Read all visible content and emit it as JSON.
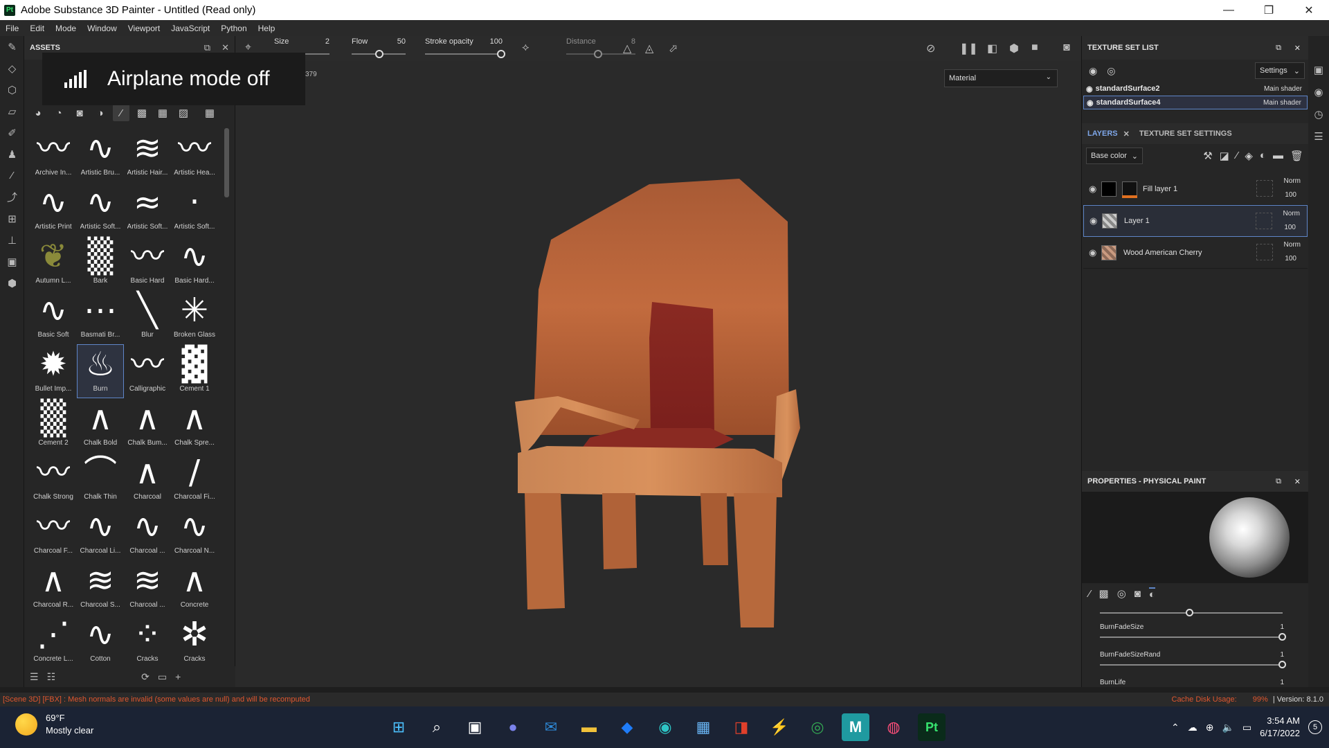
{
  "window": {
    "title": "Adobe Substance 3D Painter - Untitled (Read only)",
    "badge": "Pt",
    "minimize": "—",
    "maximize": "❐",
    "close": "✕"
  },
  "menu": [
    "File",
    "Edit",
    "Mode",
    "Window",
    "Viewport",
    "JavaScript",
    "Python",
    "Help"
  ],
  "assets": {
    "title": "ASSETS",
    "items": [
      "Archive In...",
      "Artistic Bru...",
      "Artistic Hair...",
      "Artistic Hea...",
      "Artistic Print",
      "Artistic Soft...",
      "Artistic Soft...",
      "Artistic Soft...",
      "Autumn L...",
      "Bark",
      "Basic Hard",
      "Basic Hard...",
      "Basic Soft",
      "Basmati Br...",
      "Blur",
      "Broken Glass",
      "Bullet Imp...",
      "Burn",
      "Calligraphic",
      "Cement 1",
      "Cement 2",
      "Chalk Bold",
      "Chalk Bum...",
      "Chalk Spre...",
      "Chalk Strong",
      "Chalk Thin",
      "Charcoal",
      "Charcoal Fi...",
      "Charcoal F...",
      "Charcoal Li...",
      "Charcoal ...",
      "Charcoal N...",
      "Charcoal R...",
      "Charcoal S...",
      "Charcoal ...",
      "Concrete",
      "Concrete L...",
      "Cotton",
      "Cracks",
      "Cracks"
    ],
    "selected": "Burn"
  },
  "toast": {
    "text": "Airplane mode off"
  },
  "toolbar": {
    "size_label": "Size",
    "size_value": "2",
    "flow_label": "Flow",
    "flow_value": "50",
    "stroke_label": "Stroke opacity",
    "stroke_value": "100",
    "distance_label": "Distance",
    "distance_value": "8"
  },
  "viewport": {
    "material_select": "Material",
    "counter": "379"
  },
  "texture_set_list": {
    "title": "TEXTURE SET LIST",
    "settings": "Settings",
    "items": [
      {
        "name": "standardSurface2",
        "shader": "Main shader"
      },
      {
        "name": "standardSurface4",
        "shader": "Main shader"
      }
    ]
  },
  "layers": {
    "tab_layers": "LAYERS",
    "tab_settings": "TEXTURE SET SETTINGS",
    "channel": "Base color",
    "items": [
      {
        "name": "Fill layer 1",
        "blend": "Norm",
        "opacity": "100"
      },
      {
        "name": "Layer 1",
        "blend": "Norm",
        "opacity": "100"
      },
      {
        "name": "Wood American Cherry",
        "blend": "Norm",
        "opacity": "100"
      }
    ]
  },
  "properties": {
    "title": "PROPERTIES - PHYSICAL PAINT",
    "params": [
      {
        "name": "BurnFadeSize",
        "value": "1"
      },
      {
        "name": "BurnFadeSizeRand",
        "value": "1"
      },
      {
        "name": "BurnLife",
        "value": "1"
      }
    ]
  },
  "status": {
    "error": "[Scene 3D] [FBX] : Mesh normals are invalid (some values are null) and will be recomputed",
    "cache_label": "Cache Disk Usage:",
    "cache_value": "99%",
    "version": "| Version: 8.1.0"
  },
  "taskbar": {
    "temp": "69°F",
    "weather": "Mostly clear",
    "time": "3:54 AM",
    "date": "6/17/2022",
    "notifications": "5"
  },
  "colors": {
    "accent": "#5f86c9",
    "error": "#e0572f",
    "taskbar": "#1b2334"
  }
}
